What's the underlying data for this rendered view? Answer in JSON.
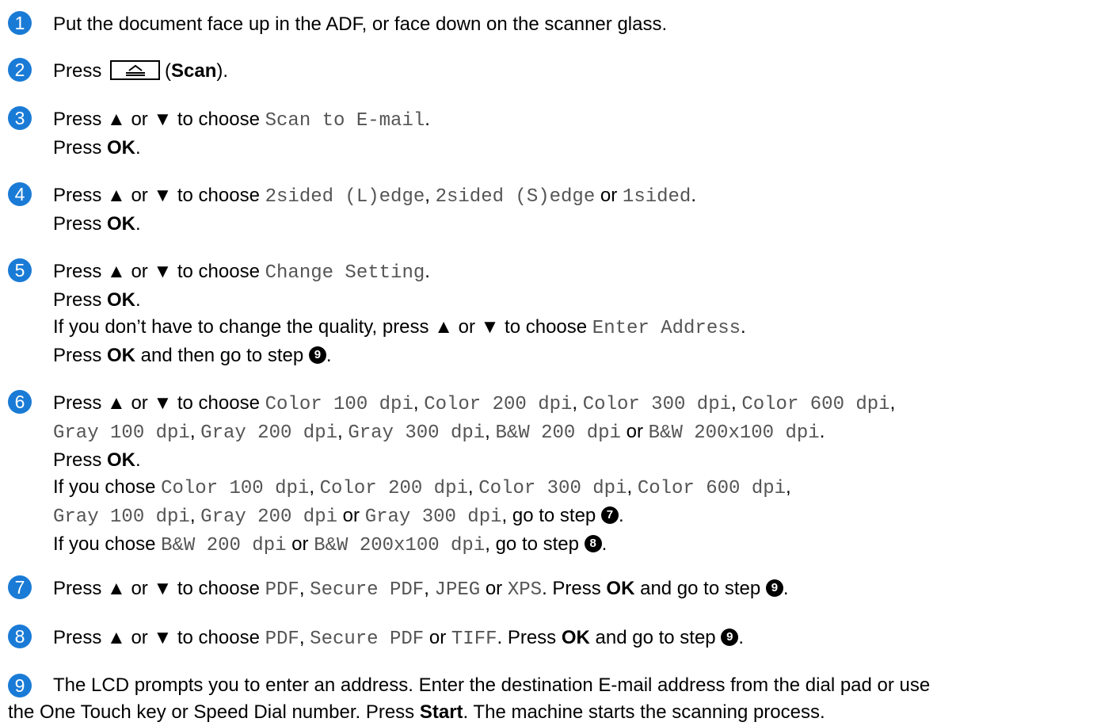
{
  "accent_color": "#1a7bd6",
  "steps": [
    {
      "n": "1",
      "text": "Put the document face up in the ADF, or face down on the scanner glass."
    },
    {
      "n": "2",
      "press": "Press",
      "key_icon": "scan-key-icon",
      "key_label": "Scan"
    },
    {
      "n": "3",
      "a": "Press ▲ or ▼ to choose ",
      "opt": "Scan to E-mail",
      "press": "Press ",
      "ok": "OK"
    },
    {
      "n": "4",
      "a": "Press ▲ or ▼ to choose ",
      "o1": "2sided (L)edge",
      "o2": "2sided (S)edge",
      "or": " or ",
      "o3": "1sided",
      "press": "Press ",
      "ok": "OK"
    },
    {
      "n": "5",
      "a": "Press ▲ or ▼ to choose ",
      "opt": "Change Setting",
      "press": "Press ",
      "ok": "OK",
      "if_text": "If you don’t have to change the quality, press ▲ or ▼ to choose ",
      "opt2": "Enter Address",
      "then_a": " and then go to step ",
      "ref": "9"
    },
    {
      "n": "6",
      "a": "Press ▲ or ▼ to choose ",
      "c100": "Color 100 dpi",
      "c200": "Color 200 dpi",
      "c300": "Color 300 dpi",
      "c600": "Color 600 dpi",
      "g100": "Gray 100 dpi",
      "g200": "Gray 200 dpi",
      "g300": "Gray 300 dpi",
      "bw200": "B&W 200 dpi",
      "bw200x100": "B&W 200x100 dpi",
      "or": " or ",
      "press": "Press ",
      "ok": "OK",
      "if_chose": "If you chose ",
      "goto": ", go to step ",
      "ref7": "7",
      "ref8": "8"
    },
    {
      "n": "7",
      "a": "Press ▲ or ▼ to choose ",
      "f1": "PDF",
      "f2": "Secure PDF",
      "f3": "JPEG",
      "f4": "XPS",
      "or": " or ",
      "press": ". Press ",
      "ok": "OK",
      "go": " and go to step ",
      "ref": "9"
    },
    {
      "n": "8",
      "a": "Press ▲ or ▼ to choose ",
      "f1": "PDF",
      "f2": "Secure PDF",
      "f3": "TIFF",
      "or": " or ",
      "press": ". Press ",
      "ok": "OK",
      "go": " and go to step ",
      "ref": "9"
    },
    {
      "n": "9",
      "l1": "The LCD prompts you to enter an address. Enter the destination E-mail address from the dial pad or use",
      "l2a": "the One Touch key or Speed Dial number. Press ",
      "start": "Start",
      "l2b": ". The machine starts the scanning process."
    }
  ]
}
